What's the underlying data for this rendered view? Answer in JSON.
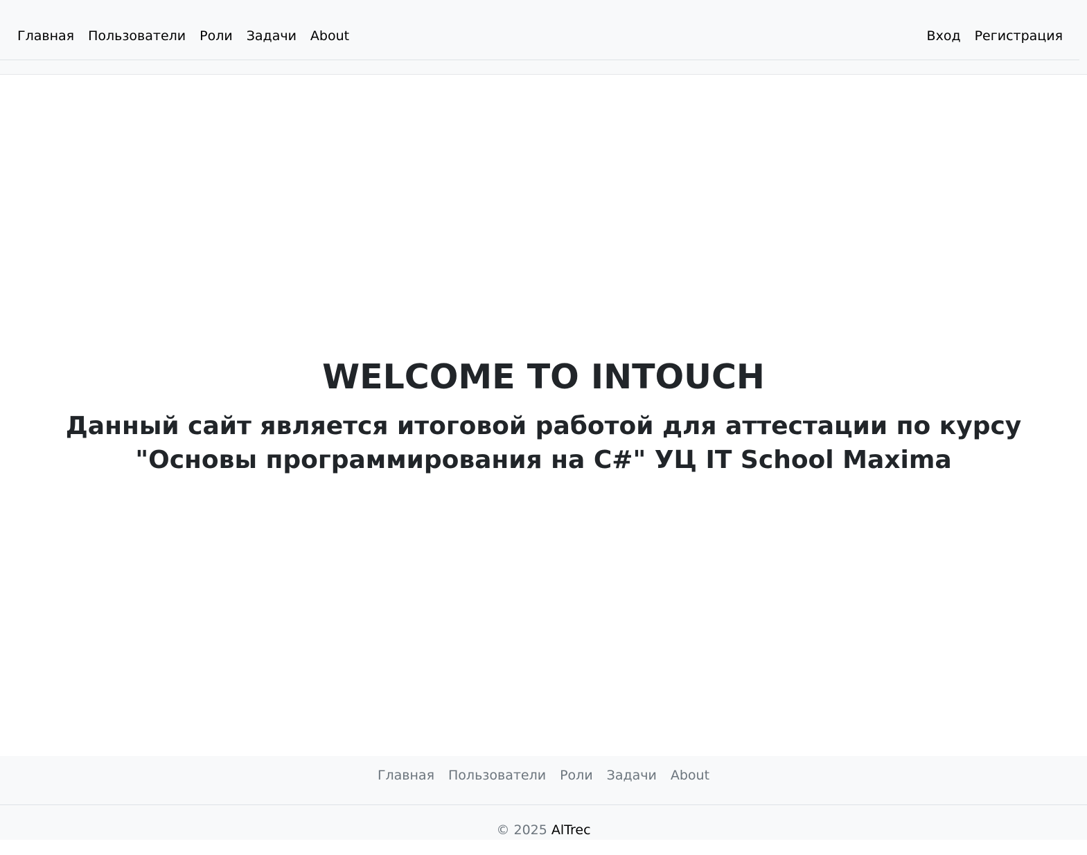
{
  "header": {
    "nav_left": [
      {
        "label": "Главная"
      },
      {
        "label": "Пользователи"
      },
      {
        "label": "Роли"
      },
      {
        "label": "Задачи"
      },
      {
        "label": "About"
      }
    ],
    "nav_right": [
      {
        "label": "Вход"
      },
      {
        "label": "Регистрация"
      }
    ]
  },
  "main": {
    "title": "WELCOME TO INTOUCH",
    "subtitle": "Данный сайт является итоговой работой для аттестации по курсу \"Основы программирования на C#\" УЦ IT School Maxima"
  },
  "footer": {
    "nav": [
      {
        "label": "Главная"
      },
      {
        "label": "Пользователи"
      },
      {
        "label": "Роли"
      },
      {
        "label": "Задачи"
      },
      {
        "label": "About"
      }
    ],
    "copyright_prefix": "© 2025",
    "copyright_brand": "AlTrec"
  },
  "colors": {
    "navbar_bg": "#f8f9fa",
    "text_dark": "#212529",
    "footer_link": "#6c757d",
    "border": "#dee2e6"
  }
}
